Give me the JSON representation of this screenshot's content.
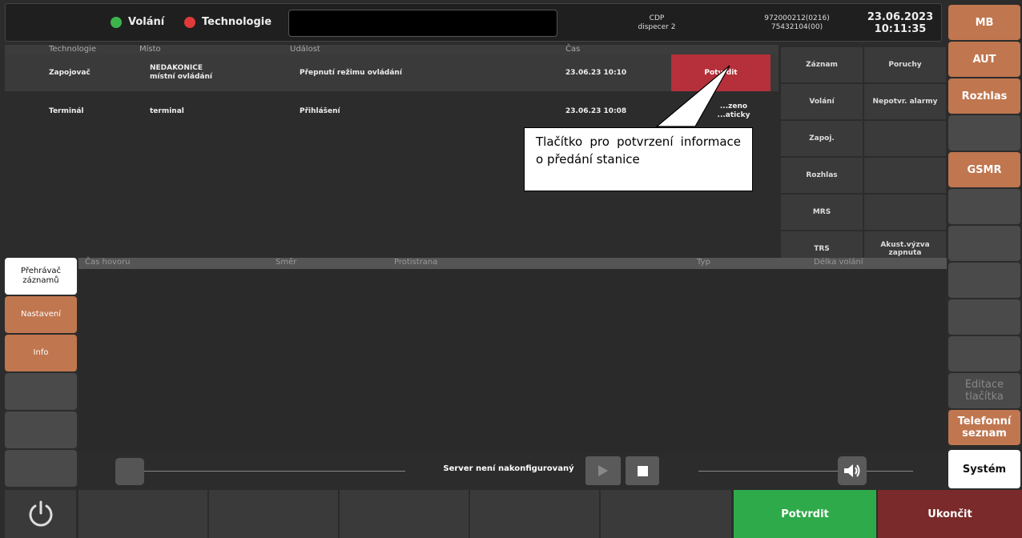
{
  "header": {
    "indicators": [
      {
        "label": "Volání",
        "color": "#3cb44b"
      },
      {
        "label": "Technologie",
        "color": "#e03a3a"
      }
    ],
    "station_line1": "CDP",
    "station_line2": "dispecer 2",
    "phone_line1": "972000212(0216)",
    "phone_line2": "75432104(00)",
    "date": "23.06.2023",
    "time": "10:11:35"
  },
  "right_menu": [
    "MB",
    "AUT",
    "Rozhlas",
    "",
    "GSMR",
    "",
    "",
    "",
    "",
    "",
    "Editace tlačítka",
    "Telefonní seznam",
    "Systém"
  ],
  "events": {
    "columns": [
      "Technologie",
      "Místo",
      "Událost",
      "Čas"
    ],
    "rows": [
      {
        "technologie": "Zapojovač",
        "misto1": "NEDAKONICE",
        "misto2": "místní ovládání",
        "udalost": "Přepnutí režimu ovládání",
        "cas": "23.06.23 10:10",
        "action": "Potvrdit"
      },
      {
        "technologie": "Terminál",
        "misto1": "terminal",
        "misto2": "",
        "udalost": "Přihlášení",
        "cas": "23.06.23 10:08",
        "action": "...zeno ...aticky"
      }
    ]
  },
  "categories": [
    [
      "Záznam",
      "Poruchy"
    ],
    [
      "Volání",
      "Nepotvr. alarmy"
    ],
    [
      "Zapoj.",
      ""
    ],
    [
      "Rozhlas",
      ""
    ],
    [
      "MRS",
      ""
    ],
    [
      "TRS",
      "Akust.výzva zapnuta"
    ]
  ],
  "left_menu": [
    "Přehrávač záznamů",
    "Nastavení",
    "Info",
    "",
    "",
    ""
  ],
  "recordings": {
    "columns": [
      "Čas hovoru",
      "Směr",
      "Protistrana",
      "Typ",
      "Délka volání"
    ],
    "status": "Server není nakonfigurovaný"
  },
  "callout": "Tlačítko pro potvrzení informace o předání stanice",
  "footer": {
    "confirm": "Potvrdit",
    "end": "Ukončit"
  }
}
